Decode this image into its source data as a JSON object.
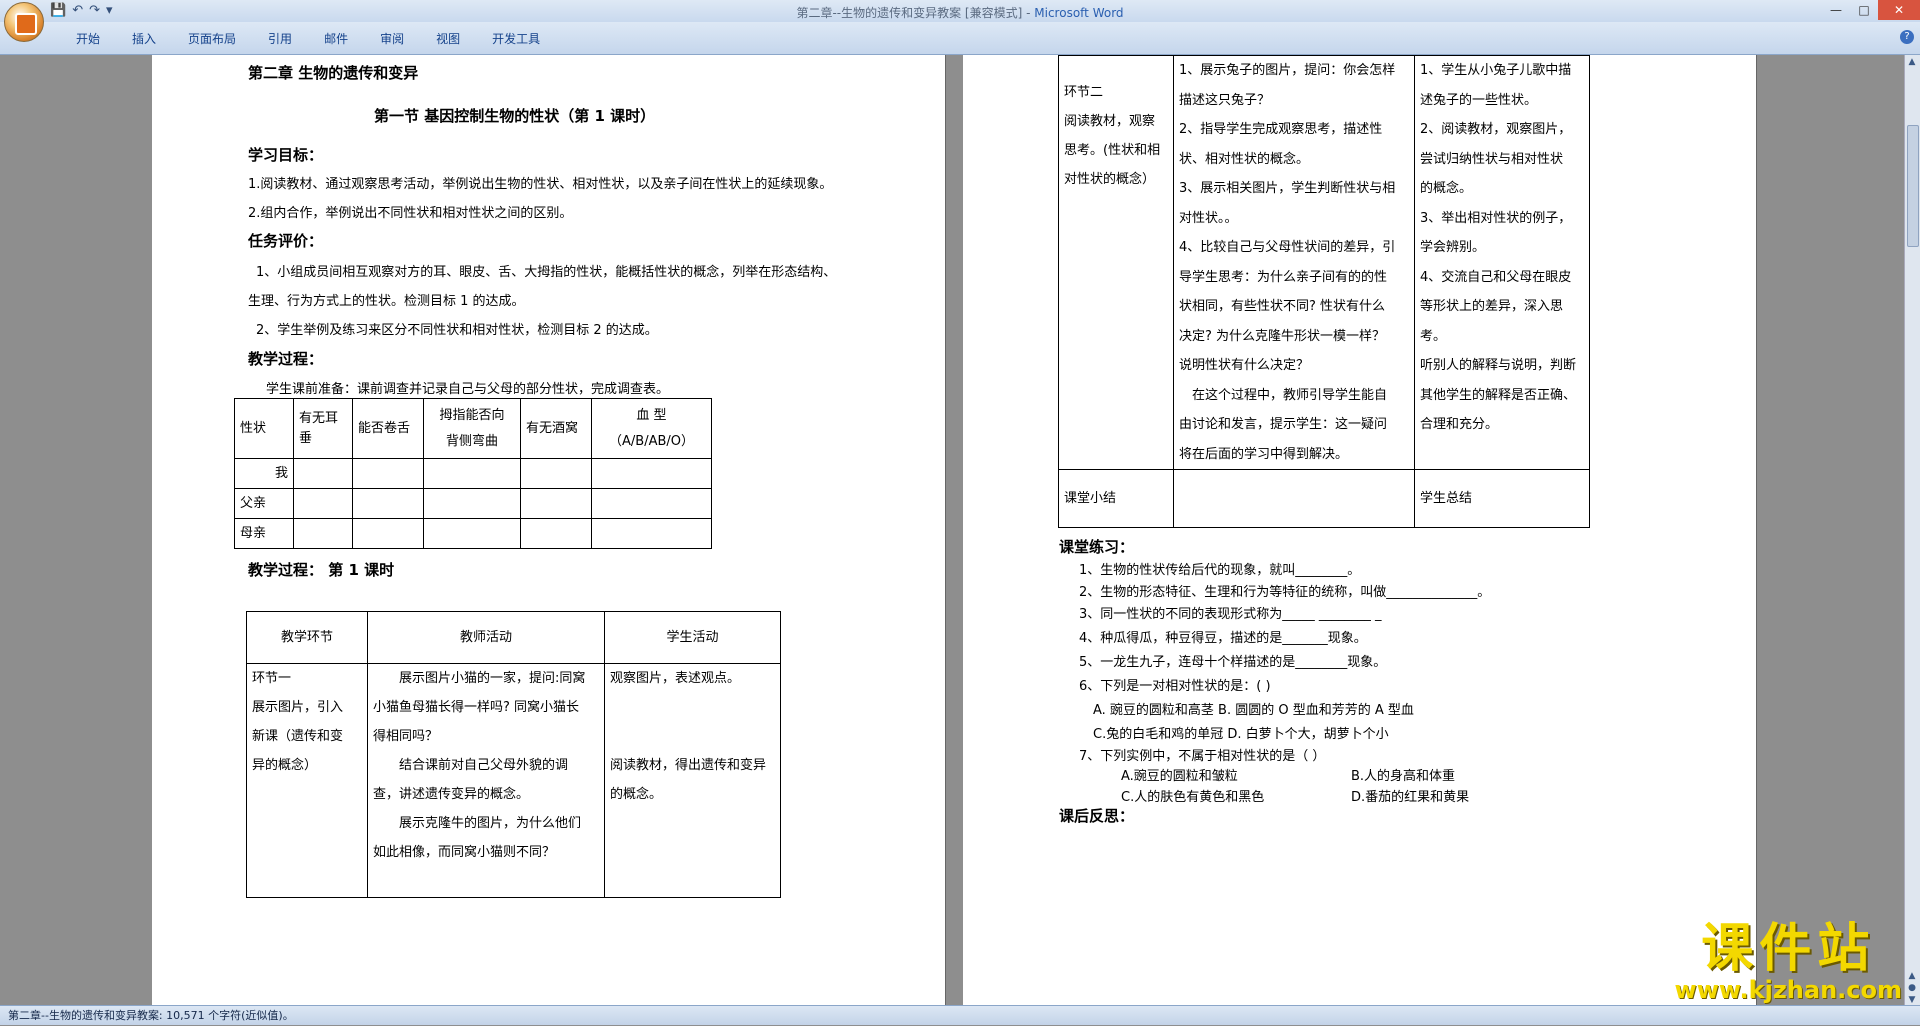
{
  "window": {
    "title": "第二章--生物的遗传和变异教案 [兼容模式] - ",
    "app_name": "Microsoft Word",
    "min": "—",
    "max": "□",
    "close": "✕"
  },
  "qat": {
    "save": "💾",
    "undo": "↶",
    "redo": "↷",
    "more": "▾"
  },
  "tabs": [
    "开始",
    "插入",
    "页面布局",
    "引用",
    "邮件",
    "审阅",
    "视图",
    "开发工具"
  ],
  "help": "?",
  "status": "第二章--生物的遗传和变异教案: 10,571 个字符(近似值)。",
  "watermark": {
    "big": "课件站",
    "url": "www.kjzhan.com"
  },
  "p1": {
    "chapter": "第二章   生物的遗传和变异",
    "section": "第一节  基因控制生物的性状（第 1 课时）",
    "goal_h": "学习目标：",
    "goal1": "1.阅读教材、通过观察思考活动，举例说出生物的性状、相对性状，以及亲子间在性状上的延续现象。",
    "goal2": "2.组内合作，举例说出不同性状和相对性状之间的区别。",
    "eval_h": "任务评价：",
    "eval1a": "1、小组成员间相互观察对方的耳、眼皮、舌、大拇指的性状，能概括性状的概念，列举在形态结构、",
    "eval1b": "生理、行为方式上的性状。检测目标 1 的达成。",
    "eval2": "2、学生举例及练习来区分不同性状和相对性状，检测目标 2 的达成。",
    "proc_h": "教学过程：",
    "prep": "学生课前准备：课前调查并记录自己与父母的部分性状，完成调查表。",
    "survey": {
      "h1": "性状",
      "h2": "有无耳垂",
      "h3": "能否卷舌",
      "h4a": "拇指能否向",
      "h4b": "背侧弯曲",
      "h5": "有无酒窝",
      "h6a": "血          型",
      "h6b": "（A/B/AB/O）",
      "r1": "我",
      "r2": "父亲",
      "r3": "母亲"
    },
    "proc2_h": "教学过程：   第 1 课时",
    "lesson": {
      "h1": "教学环节",
      "h2": "教师活动",
      "h3": "学生活动",
      "c1": [
        "环节一",
        "展示图片，引入",
        "新课（遗传和变",
        "异的概念）"
      ],
      "c2": [
        "展示图片小猫的一家，提问:同窝",
        "小猫鱼母猫长得一样吗? 同窝小猫长",
        "得相同吗？",
        "结合课前对自己父母外貌的调",
        "查，讲述遗传变异的概念。",
        "展示克隆牛的图片，为什么他们",
        "如此相像，而同窝小猫则不同？"
      ],
      "c3": [
        "观察图片，表述观点。",
        "",
        "",
        "阅读教材，得出遗传和变异",
        "的概念。"
      ]
    }
  },
  "p2": {
    "t_c1": [
      "",
      "环节二",
      "阅读教材，观察",
      "思考。(性状和相",
      "对性状的概念）"
    ],
    "t_c2": [
      "1、展示兔子的图片，提问：你会怎样",
      "描述这只兔子？",
      "2、指导学生完成观察思考，描述性",
      "状、相对性状的概念。",
      "3、展示相关图片，学生判断性状与相",
      "对性状。。",
      "4、比较自己与父母性状间的差异，引",
      "导学生思考：为什么亲子间有的的性",
      "状相同，有些性状不同? 性状有什么",
      "决定? 为什么克隆牛形状一模一样？",
      "说明性状有什么决定？",
      "在这个过程中，教师引导学生能自",
      "由讨论和发言，提示学生：这一疑问",
      "将在后面的学习中得到解决。"
    ],
    "t_c3": [
      "1、学生从小兔子儿歌中描",
      "述兔子的一些性状。",
      "2、阅读教材，观察图片，",
      "尝试归纳性状与相对性状",
      "的概念。",
      "3、举出相对性状的例子，",
      "学会辨别。",
      "4、交流自己和父母在眼皮",
      "等形状上的差异，深入思",
      "考。",
      "听别人的解释与说明，判断",
      "其他学生的解释是否正确、",
      "合理和充分。"
    ],
    "sum1": "课堂小结",
    "sum3": "学生总结",
    "ex_h": "课堂练习：",
    "ex": [
      "1、生物的性状传给后代的现象，就叫________。",
      "2、生物的形态特征、生理和行为等特征的统称，叫做______________。",
      "3、同一性状的不同的表现形式称为_____ ________ _",
      "4、种瓜得瓜，种豆得豆，描述的是_______现象。",
      "5、一龙生九子，连母十个样描述的是________现象。",
      "6、下列是一对相对性状的是：(     )",
      "A. 豌豆的圆粒和高茎     B. 圆圆的 O 型血和芳芳的 A 型血",
      "C.兔的白毛和鸡的单冠    D. 白萝卜个大，胡萝卜个小",
      "7、下列实例中，不属于相对性状的是（        ）",
      "A.豌豆的圆粒和皱粒",
      "B.人的身高和体重",
      "C.人的肤色有黄色和黑色",
      "D.番茄的红果和黄果"
    ],
    "refl_h": "课后反思："
  }
}
